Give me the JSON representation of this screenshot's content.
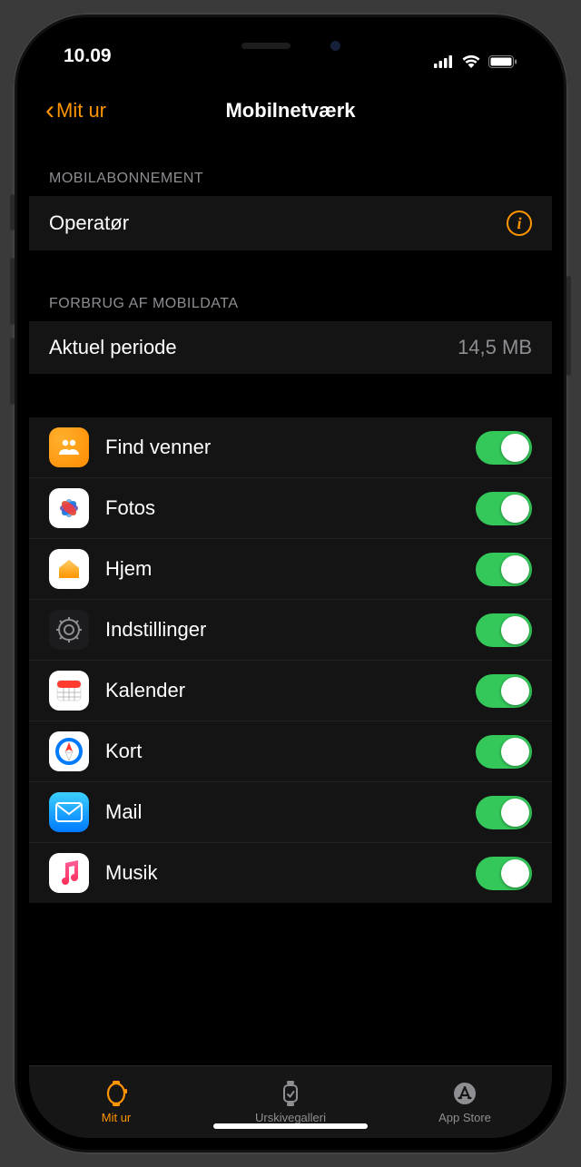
{
  "status": {
    "time": "10.09"
  },
  "nav": {
    "back": "Mit ur",
    "title": "Mobilnetværk"
  },
  "sections": {
    "plan_header": "MOBILABONNEMENT",
    "carrier_label": "Operatør",
    "usage_header": "FORBRUG AF MOBILDATA",
    "period_label": "Aktuel periode",
    "period_value": "14,5 MB"
  },
  "apps": [
    {
      "name": "Find venner",
      "icon": "find-friends-icon",
      "enabled": true
    },
    {
      "name": "Fotos",
      "icon": "photos-icon",
      "enabled": true
    },
    {
      "name": "Hjem",
      "icon": "home-icon",
      "enabled": true
    },
    {
      "name": "Indstillinger",
      "icon": "settings-icon",
      "enabled": true
    },
    {
      "name": "Kalender",
      "icon": "calendar-icon",
      "enabled": true
    },
    {
      "name": "Kort",
      "icon": "maps-icon",
      "enabled": true
    },
    {
      "name": "Mail",
      "icon": "mail-icon",
      "enabled": true
    },
    {
      "name": "Musik",
      "icon": "music-icon",
      "enabled": true
    }
  ],
  "tabs": {
    "watch": "Mit ur",
    "gallery": "Urskivegalleri",
    "appstore": "App Store"
  },
  "colors": {
    "accent": "#ff9500",
    "toggle_on": "#34c759"
  }
}
